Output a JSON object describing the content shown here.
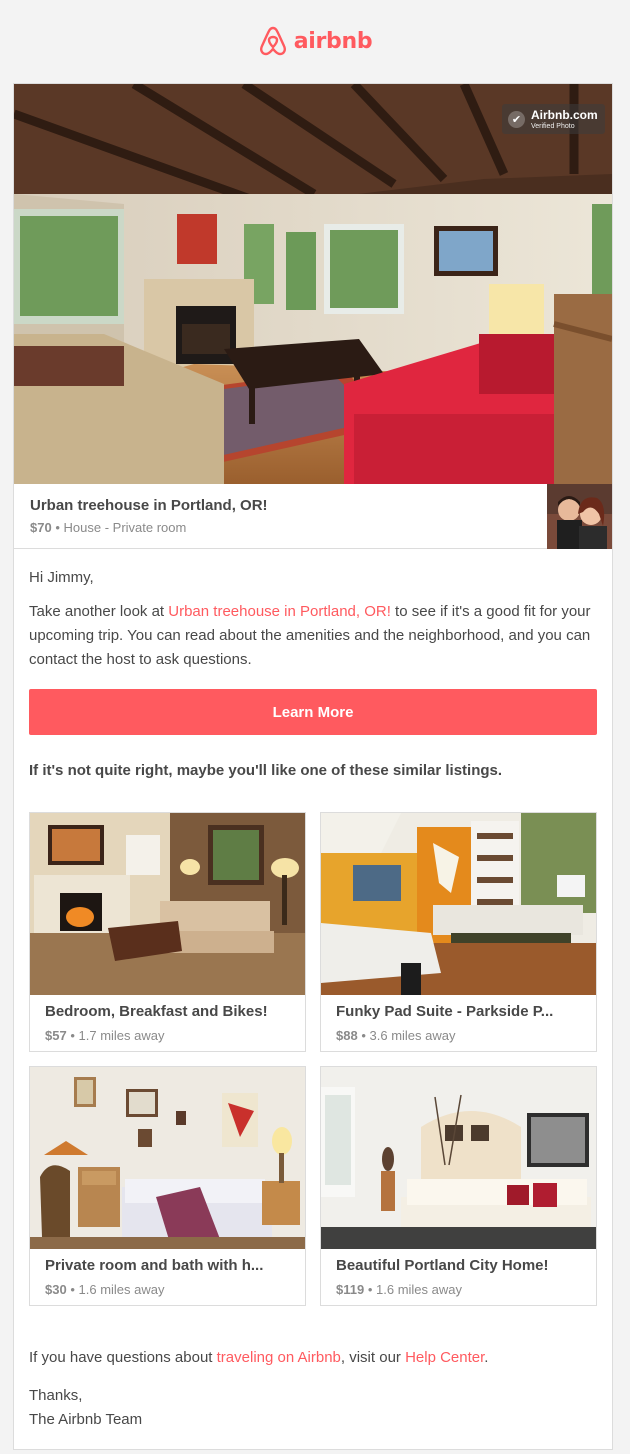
{
  "brand": {
    "name": "airbnb",
    "color": "#ff5a5f"
  },
  "hero": {
    "badge_title": "Airbnb.com",
    "badge_subtitle": "Verified Photo",
    "icon": "checkmark-icon"
  },
  "listing": {
    "title": "Urban treehouse in Portland, OR!",
    "price": "$70",
    "separator": "•",
    "type": "House - Private room"
  },
  "message": {
    "greeting": "Hi Jimmy,",
    "pre": "Take another look at ",
    "link": "Urban treehouse in Portland, OR!",
    "post": " to see if it's a good fit for your upcoming trip. You can read about the amenities and the neighborhood, and you can contact the host to ask questions."
  },
  "cta": {
    "label": "Learn More"
  },
  "similar": {
    "heading": "If it's not quite right, maybe you'll like one of these similar listings.",
    "items": [
      {
        "title": "Bedroom, Breakfast and Bikes!",
        "price": "$57",
        "distance": "1.7 miles away"
      },
      {
        "title": "Funky Pad Suite - Parkside P...",
        "price": "$88",
        "distance": "3.6 miles away"
      },
      {
        "title": "Private room and bath with h...",
        "price": "$30",
        "distance": "1.6 miles away"
      },
      {
        "title": "Beautiful Portland City Home!",
        "price": "$119",
        "distance": "1.6 miles away"
      }
    ]
  },
  "footer": {
    "pre": "If you have questions about ",
    "link1": "traveling on Airbnb",
    "mid": ", visit our ",
    "link2": "Help Center",
    "post": ".",
    "thanks": "Thanks,",
    "signature": "The Airbnb Team"
  }
}
